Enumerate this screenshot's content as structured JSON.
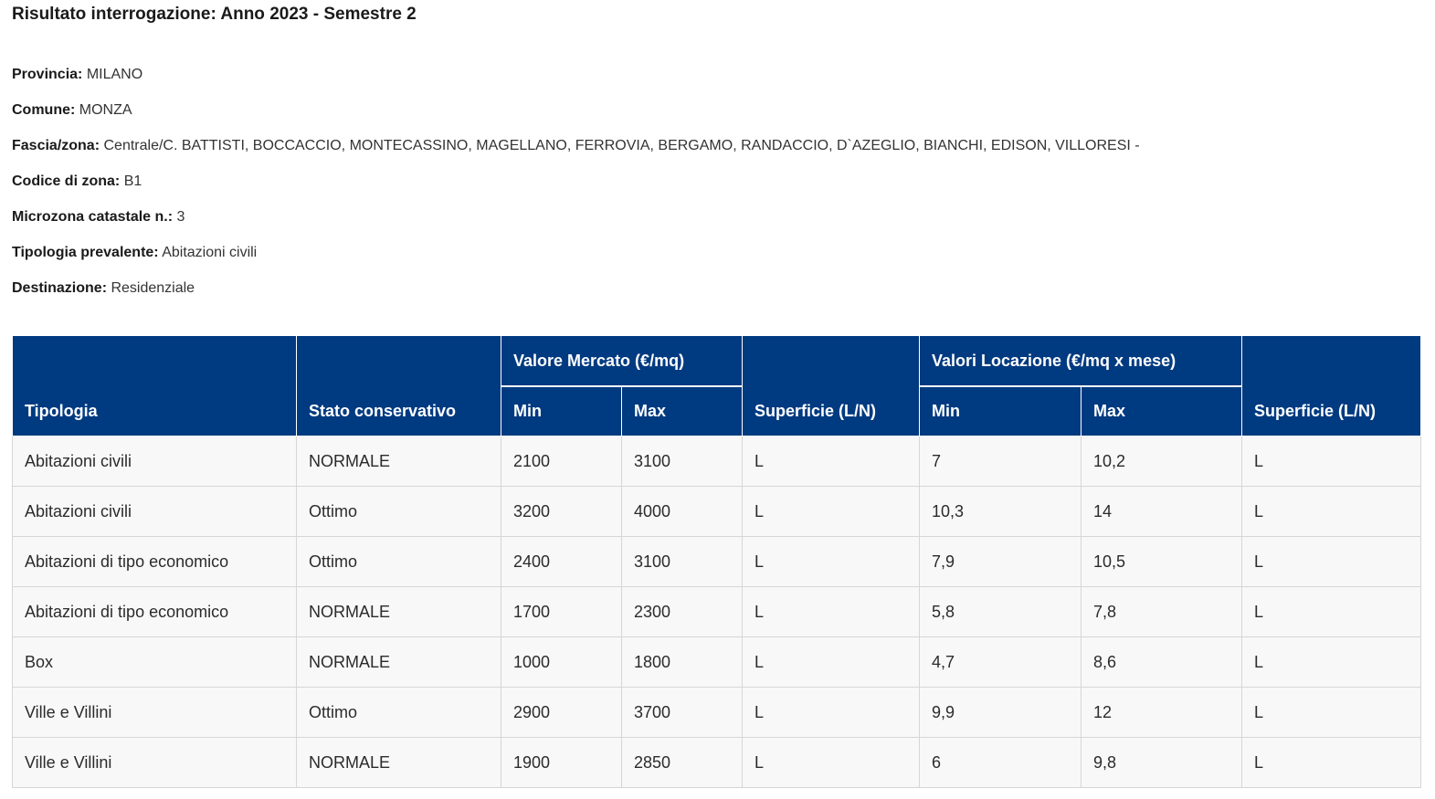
{
  "header": {
    "title_label": "Risultato interrogazione:",
    "title_value": "Anno 2023 - Semestre 2"
  },
  "info": [
    {
      "label": "Provincia:",
      "value": "MILANO"
    },
    {
      "label": "Comune:",
      "value": "MONZA"
    },
    {
      "label": "Fascia/zona:",
      "value": "Centrale/C. BATTISTI, BOCCACCIO, MONTECASSINO, MAGELLANO, FERROVIA, BERGAMO, RANDACCIO, D`AZEGLIO, BIANCHI, EDISON, VILLORESI -"
    },
    {
      "label": "Codice di zona:",
      "value": "B1"
    },
    {
      "label": "Microzona catastale n.:",
      "value": "3"
    },
    {
      "label": "Tipologia prevalente:",
      "value": "Abitazioni civili"
    },
    {
      "label": "Destinazione:",
      "value": "Residenziale"
    }
  ],
  "table": {
    "headers": {
      "tipologia": "Tipologia",
      "stato": "Stato conservativo",
      "valore_mercato": "Valore Mercato (€/mq)",
      "vm_min": "Min",
      "vm_max": "Max",
      "superficie_1": "Superficie (L/N)",
      "valori_locazione": "Valori Locazione (€/mq x mese)",
      "vl_min": "Min",
      "vl_max": "Max",
      "superficie_2": "Superficie (L/N)"
    },
    "rows": [
      [
        "Abitazioni civili",
        "NORMALE",
        "2100",
        "3100",
        "L",
        "7",
        "10,2",
        "L"
      ],
      [
        "Abitazioni civili",
        "Ottimo",
        "3200",
        "4000",
        "L",
        "10,3",
        "14",
        "L"
      ],
      [
        "Abitazioni di tipo economico",
        "Ottimo",
        "2400",
        "3100",
        "L",
        "7,9",
        "10,5",
        "L"
      ],
      [
        "Abitazioni di tipo economico",
        "NORMALE",
        "1700",
        "2300",
        "L",
        "5,8",
        "7,8",
        "L"
      ],
      [
        "Box",
        "NORMALE",
        "1000",
        "1800",
        "L",
        "4,7",
        "8,6",
        "L"
      ],
      [
        "Ville e Villini",
        "Ottimo",
        "2900",
        "3700",
        "L",
        "9,9",
        "12",
        "L"
      ],
      [
        "Ville e Villini",
        "NORMALE",
        "1900",
        "2850",
        "L",
        "6",
        "9,8",
        "L"
      ]
    ]
  },
  "colors": {
    "header_bg": "#003a80",
    "row_bg": "#f8f8f8",
    "border": "#d6d6d6"
  }
}
